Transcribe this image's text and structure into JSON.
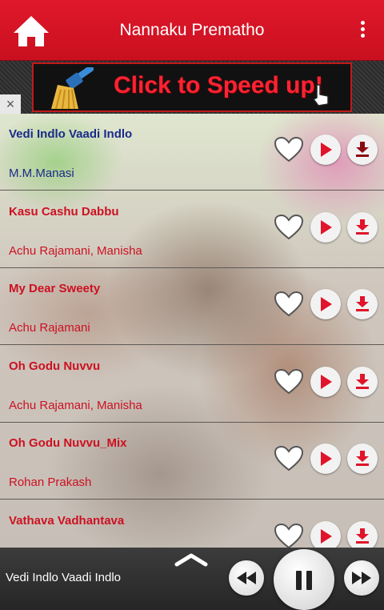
{
  "header": {
    "title": "Nannaku Prematho",
    "home_icon": "home-icon",
    "menu_icon": "overflow-menu-icon",
    "color": "#d7172a"
  },
  "ad": {
    "text": "Click to Speed up!",
    "close_label": "×",
    "icon": "broom-icon"
  },
  "songs": [
    {
      "title": "Vedi Indlo Vaadi Indlo",
      "artist": "M.M.Manasi",
      "current": true
    },
    {
      "title": "Kasu Cashu Dabbu",
      "artist": "Achu Rajamani, Manisha",
      "current": false
    },
    {
      "title": "My Dear Sweety",
      "artist": "Achu Rajamani",
      "current": false
    },
    {
      "title": "Oh Godu Nuvvu",
      "artist": "Achu Rajamani, Manisha",
      "current": false
    },
    {
      "title": "Oh Godu Nuvvu_Mix",
      "artist": "Rohan Prakash",
      "current": false
    },
    {
      "title": "Vathava Vadhantava",
      "artist": "",
      "current": false
    }
  ],
  "player": {
    "now_playing": "Vedi Indlo Vaadi Indlo",
    "state": "playing"
  },
  "colors": {
    "accent": "#cc1122",
    "current_song": "#1b2a8a"
  }
}
